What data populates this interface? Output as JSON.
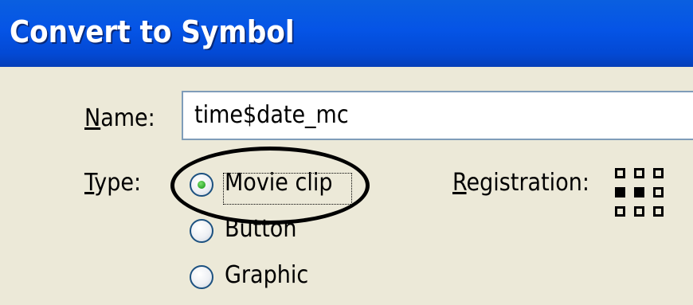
{
  "window": {
    "title": "Convert to Symbol"
  },
  "form": {
    "name_label_mnemonic": "N",
    "name_label_rest": "ame:",
    "name_value": "time$date_mc",
    "type_label_mnemonic": "T",
    "type_label_rest": "ype:",
    "type_options": [
      {
        "label": "Movie clip",
        "selected": true
      },
      {
        "label": "Button",
        "selected": false
      },
      {
        "label": "Graphic",
        "selected": false
      }
    ],
    "registration_label_mnemonic": "R",
    "registration_label_rest": "egistration:",
    "registration_selected": "center-left"
  },
  "annotation": {
    "shape": "ellipse",
    "color": "#000000",
    "target": "Movie clip"
  },
  "colors": {
    "titlebar": "#0554e6",
    "title_text": "#ffffff",
    "dialog_bg": "#ece9d8",
    "radio_dot": "#2fa82c",
    "input_border": "#7f9db9"
  }
}
